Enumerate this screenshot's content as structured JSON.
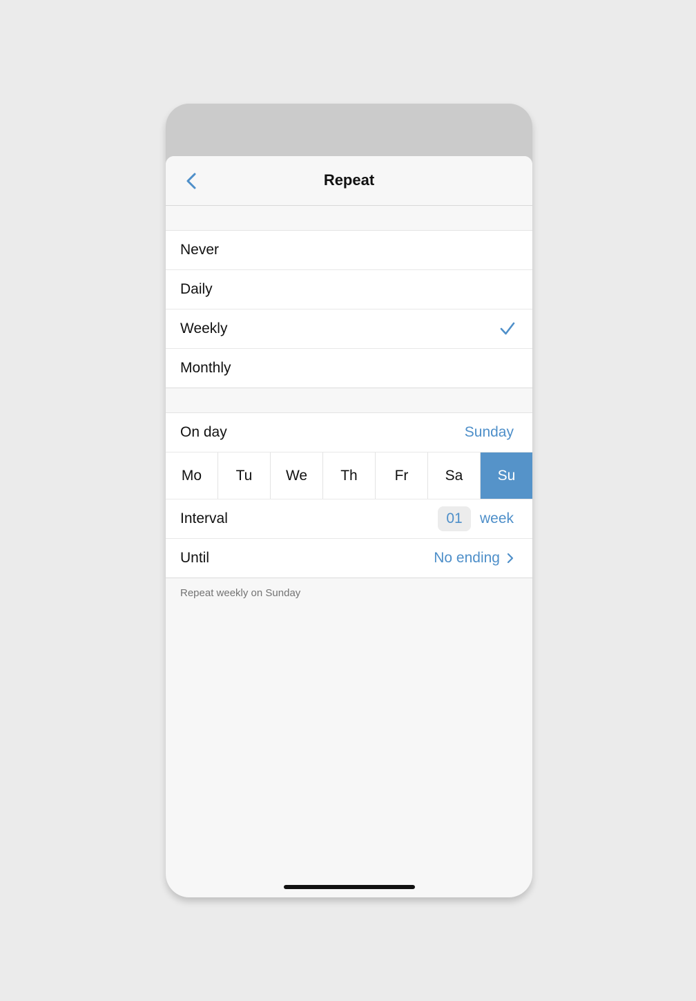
{
  "nav": {
    "title": "Repeat",
    "back_icon": "chevron-left-icon",
    "accent_color": "#4e8fc9"
  },
  "frequency": {
    "options": [
      "Never",
      "Daily",
      "Weekly",
      "Monthly"
    ],
    "selected": "Weekly"
  },
  "on_day": {
    "label": "On day",
    "value": "Sunday"
  },
  "days": {
    "items": [
      "Mo",
      "Tu",
      "We",
      "Th",
      "Fr",
      "Sa",
      "Su"
    ],
    "selected": "Su",
    "selected_color": "#5593c9"
  },
  "interval": {
    "label": "Interval",
    "value": "01",
    "unit": "week"
  },
  "until": {
    "label": "Until",
    "value": "No ending"
  },
  "summary": "Repeat weekly on Sunday"
}
